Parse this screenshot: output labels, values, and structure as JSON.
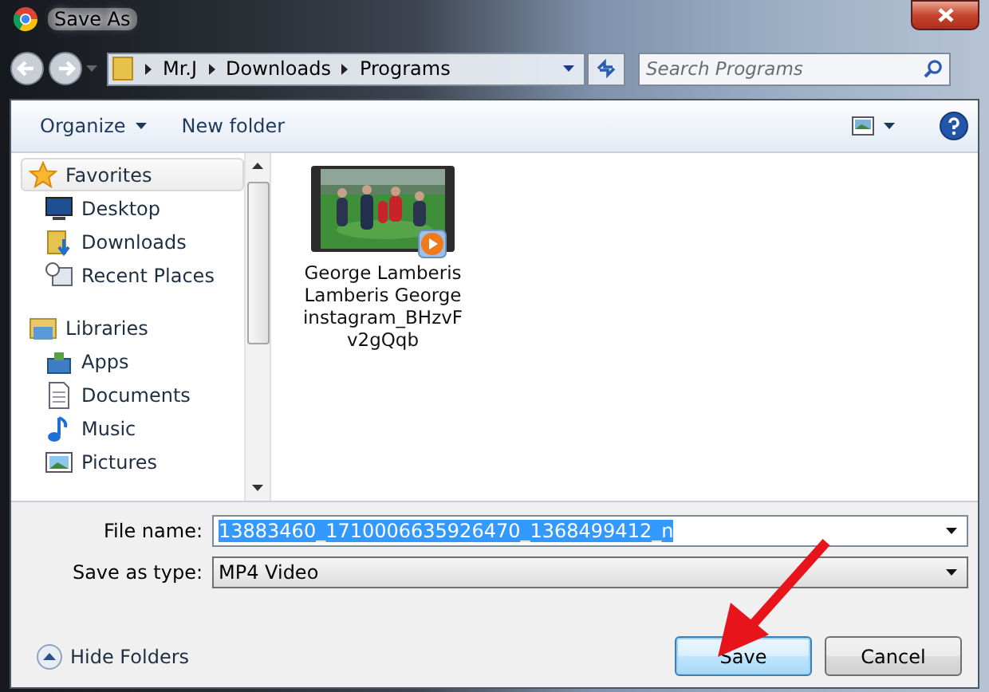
{
  "window": {
    "title": "Save As"
  },
  "breadcrumb": [
    {
      "label": "Mr.J"
    },
    {
      "label": "Downloads"
    },
    {
      "label": "Programs"
    }
  ],
  "search": {
    "placeholder": "Search Programs"
  },
  "toolbar": {
    "organize": "Organize",
    "new_folder": "New folder"
  },
  "sidebar": {
    "items": [
      {
        "label": "Favorites",
        "selected": true,
        "children": [
          {
            "label": "Desktop",
            "selected": false
          },
          {
            "label": "Downloads",
            "selected": false
          },
          {
            "label": "Recent Places",
            "selected": false
          }
        ]
      },
      {
        "label": "Libraries",
        "selected": false,
        "children": [
          {
            "label": "Apps",
            "selected": false
          },
          {
            "label": "Documents",
            "selected": false
          },
          {
            "label": "Music",
            "selected": false
          },
          {
            "label": "Pictures",
            "selected": false
          }
        ]
      }
    ]
  },
  "files": [
    {
      "label_lines": [
        "George Lamberis",
        "Lamberis George",
        "instagram_BHzvF",
        "v2gQqb"
      ],
      "kind": "video"
    }
  ],
  "form": {
    "file_name": {
      "label": "File name:",
      "value": "13883460_1710006635926470_1368499412_n",
      "selected": true
    },
    "save_type": {
      "label": "Save as type:",
      "value": "MP4 Video"
    }
  },
  "hide_folders": "Hide Folders",
  "buttons": [
    {
      "label": "Save",
      "kind": "default"
    },
    {
      "label": "Cancel",
      "kind": "normal"
    }
  ]
}
